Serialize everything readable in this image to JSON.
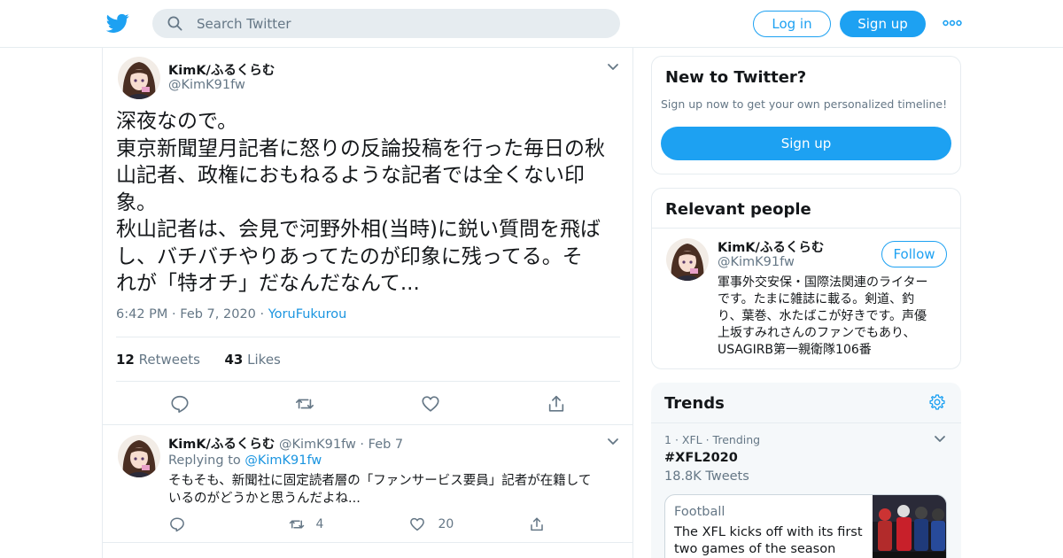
{
  "header": {
    "search_placeholder": "Search Twitter",
    "login_label": "Log in",
    "signup_label": "Sign up"
  },
  "tweet": {
    "author_name": "KimK/ふるくらむ",
    "author_handle": "@KimK91fw",
    "text_lines": [
      "深夜なので。",
      "東京新聞望月記者に怒りの反論投稿を行った毎日の秋",
      "山記者、政権におもねるような記者では全くない印",
      "象。",
      "秋山記者は、会見で河野外相(当時)に鋭い質問を飛ば",
      "し、バチバチやりあってたのが印象に残ってる。そ",
      "れが「特オチ」だなんだなんて..."
    ],
    "time": "6:42 PM",
    "date": "Feb 7, 2020",
    "source": "YoruFukurou",
    "retweets_count": "12",
    "retweets_label": "Retweets",
    "likes_count": "43",
    "likes_label": "Likes"
  },
  "reply": {
    "author_name": "KimK/ふるくらむ",
    "author_handle": "@KimK91fw",
    "date": "Feb 7",
    "replying_label": "Replying to",
    "replying_handle": "@KimK91fw",
    "text_lines": [
      "そもそも、新聞社に固定読者層の「ファンサービス要員」記者が在籍して",
      "いるのがどうかと思うんだよね..."
    ],
    "retweets": "4",
    "likes": "20"
  },
  "sidebar": {
    "new_title": "New to Twitter?",
    "new_subtitle": "Sign up now to get your own personalized timeline!",
    "signup_label": "Sign up",
    "relevant_title": "Relevant people",
    "person_name": "KimK/ふるくらむ",
    "person_handle": "@KimK91fw",
    "follow_label": "Follow",
    "bio_lines": [
      "軍事外交安保・国際法関連のライター",
      "です。たまに雑誌に載る。剣道、釣",
      "り、葉巻、水たばこが好きです。声優",
      "上坂すみれさんのファンでもあり、",
      "USAGIRB第一親衛隊106番"
    ],
    "trends_title": "Trends",
    "trend_rank": "1",
    "trend_topic": "XFL",
    "trend_status": "Trending",
    "trend_tag": "#XFL2020",
    "trend_count": "18.8K Tweets",
    "news_category": "Football",
    "news_title_lines": [
      "The XFL kicks off with its first",
      "two games of the season"
    ]
  },
  "colors": {
    "brand_blue": "#1da1f2",
    "link_blue": "#1b95e0",
    "text_gray": "#657786",
    "border": "#e6ecf0"
  },
  "icons": [
    "twitter-bird-icon",
    "search-icon",
    "more-dots-icon",
    "chevron-down-icon",
    "reply-icon",
    "retweet-icon",
    "like-icon",
    "share-icon",
    "gear-icon"
  ]
}
